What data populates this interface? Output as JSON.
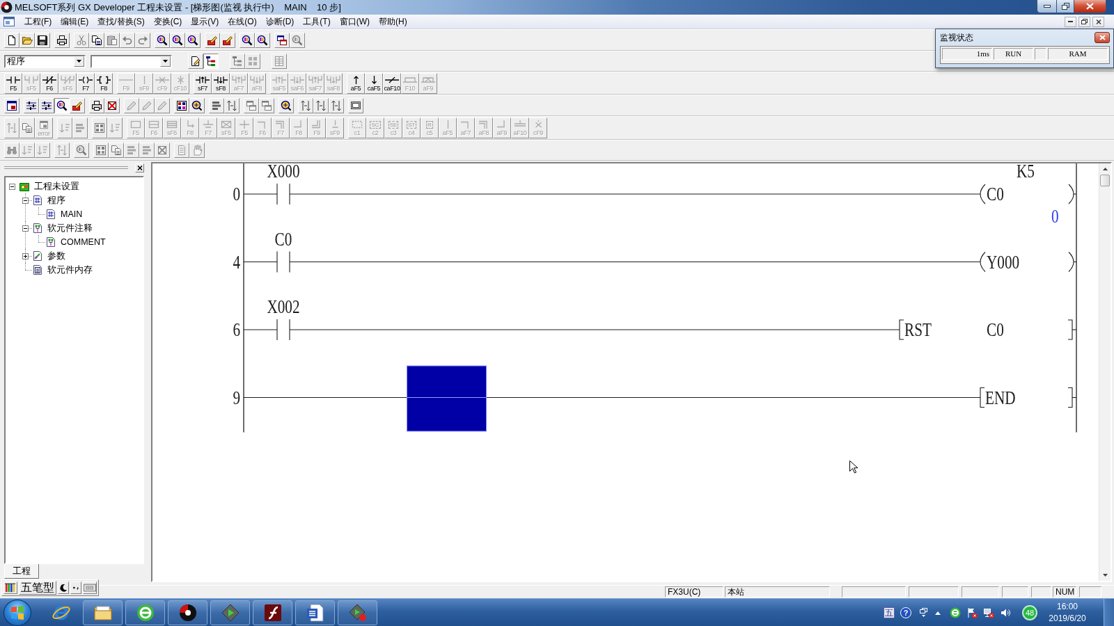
{
  "window": {
    "title": "MELSOFT系列 GX Developer 工程未设置 - [梯形图(监视 执行中)    MAIN    10 步]"
  },
  "menu": [
    "工程(F)",
    "编辑(E)",
    "查找/替换(S)",
    "变换(C)",
    "显示(V)",
    "在线(O)",
    "诊断(D)",
    "工具(T)",
    "窗口(W)",
    "帮助(H)"
  ],
  "toolbars": [
    {
      "groups": [
        [
          {
            "disabled": false
          },
          {
            "disabled": false
          },
          {
            "disabled": false
          }
        ],
        [
          {
            "disabled": false
          }
        ],
        [
          {
            "disabled": true
          },
          {
            "disabled": false
          },
          {
            "disabled": true
          },
          {
            "disabled": true
          },
          {
            "disabled": true
          }
        ],
        [
          {
            "disabled": false
          },
          {
            "disabled": false
          },
          {
            "disabled": false
          }
        ],
        [
          {
            "disabled": false
          },
          {
            "disabled": false
          }
        ],
        [
          {
            "disabled": false
          },
          {
            "disabled": false
          }
        ],
        [
          {
            "disabled": false
          },
          {
            "disabled": true
          }
        ]
      ]
    },
    {
      "groups": [
        [
          {
            "kind": "combo",
            "value": "程序"
          },
          {
            "kind": "combo"
          }
        ],
        [
          {
            "kind": "button",
            "disabled": false,
            "pressed": false
          },
          {
            "kind": "button",
            "disabled": false,
            "pressed": true
          }
        ],
        [
          {
            "kind": "button",
            "disabled": true
          },
          {
            "kind": "button",
            "disabled": true
          }
        ],
        [
          {
            "kind": "button",
            "disabled": true
          }
        ]
      ]
    },
    {
      "groups": [
        [
          {
            "key": "F5",
            "disabled": false
          },
          {
            "key": "sF5",
            "disabled": true
          },
          {
            "key": "F6",
            "disabled": false
          },
          {
            "key": "sF6",
            "disabled": true
          },
          {
            "key": "F7",
            "disabled": false
          },
          {
            "key": "F8",
            "disabled": false
          }
        ],
        [
          {
            "key": "F9",
            "disabled": true
          },
          {
            "key": "sF9",
            "disabled": true
          },
          {
            "key": "cF9",
            "disabled": true
          },
          {
            "key": "cF10",
            "disabled": true
          }
        ],
        [
          {
            "key": "sF7",
            "disabled": false
          },
          {
            "key": "sF8",
            "disabled": false
          },
          {
            "key": "aF7",
            "disabled": true
          },
          {
            "key": "aF8",
            "disabled": true
          }
        ],
        [
          {
            "key": "saF5",
            "disabled": true
          },
          {
            "key": "saF6",
            "disabled": true
          },
          {
            "key": "saF7",
            "disabled": true
          },
          {
            "key": "saF8",
            "disabled": true
          }
        ],
        [
          {
            "key": "aF5",
            "disabled": false
          },
          {
            "key": "caF5",
            "disabled": false
          },
          {
            "key": "caF10",
            "disabled": false
          },
          {
            "key": "F10",
            "disabled": true
          },
          {
            "key": "aF9",
            "disabled": true
          }
        ]
      ]
    },
    {
      "groups": [
        [
          {
            "disabled": false
          }
        ],
        [
          {
            "disabled": false,
            "pressed": false
          },
          {
            "disabled": false,
            "pressed": false
          },
          {
            "disabled": false,
            "pressed": true
          },
          {
            "disabled": false,
            "pressed": false
          }
        ],
        [
          {
            "disabled": false
          },
          {
            "disabled": false
          }
        ],
        [
          {
            "disabled": true
          },
          {
            "disabled": true
          },
          {
            "disabled": true
          }
        ],
        [
          {
            "disabled": false
          },
          {
            "disabled": false
          }
        ],
        [
          {
            "disabled": false
          },
          {
            "disabled": false
          }
        ],
        [
          {
            "disabled": true
          },
          {
            "disabled": true
          }
        ],
        [
          {
            "disabled": false
          }
        ],
        [
          {
            "disabled": false
          },
          {
            "disabled": false
          },
          {
            "disabled": false
          }
        ],
        [
          {
            "disabled": false
          }
        ]
      ]
    },
    {
      "groups": [
        [
          {
            "disabled": true
          },
          {
            "disabled": true
          },
          {
            "key": "error",
            "disabled": true
          }
        ],
        [
          {
            "disabled": true
          },
          {
            "disabled": true
          }
        ],
        [
          {
            "disabled": true
          },
          {
            "disabled": true
          }
        ],
        [
          {
            "key": "F5",
            "disabled": true
          },
          {
            "key": "F6",
            "disabled": true
          },
          {
            "key": "sF6",
            "disabled": true
          },
          {
            "key": "F8",
            "disabled": true
          },
          {
            "key": "F7",
            "disabled": true
          },
          {
            "key": "sF5",
            "disabled": true
          },
          {
            "key": "F5",
            "disabled": true
          },
          {
            "key": "F6",
            "disabled": true
          },
          {
            "key": "F7",
            "disabled": true
          },
          {
            "key": "F8",
            "disabled": true
          },
          {
            "key": "F9",
            "disabled": true
          },
          {
            "key": "sF9",
            "disabled": true
          }
        ],
        [
          {
            "key": "c1",
            "disabled": true
          },
          {
            "tag": "SC",
            "key": "c2",
            "disabled": true
          },
          {
            "tag": "SE",
            "key": "c3",
            "disabled": true
          },
          {
            "tag": "ST",
            "key": "c4",
            "disabled": true
          },
          {
            "tag": "R",
            "key": "c5",
            "disabled": true
          },
          {
            "key": "aF5",
            "disabled": true
          },
          {
            "key": "aF7",
            "disabled": true
          },
          {
            "key": "aF8",
            "disabled": true
          },
          {
            "key": "aF9",
            "disabled": true
          },
          {
            "key": "aF10",
            "disabled": true
          },
          {
            "key": "cF9",
            "disabled": true
          }
        ]
      ]
    },
    {
      "groups": [
        [
          {
            "disabled": true
          },
          {
            "disabled": true
          },
          {
            "disabled": true
          }
        ],
        [
          {
            "disabled": true
          }
        ],
        [
          {
            "disabled": true
          }
        ],
        [
          {
            "disabled": true
          },
          {
            "disabled": true
          },
          {
            "disabled": true
          },
          {
            "disabled": true
          },
          {
            "disabled": true
          }
        ],
        [
          {
            "disabled": true
          },
          {
            "disabled": true
          }
        ]
      ]
    }
  ],
  "monitor_window": {
    "title": "监视状态",
    "scan_time": "1ms",
    "status": "RUN",
    "memory": "RAM"
  },
  "left_panel": {
    "tree": [
      {
        "label": "工程未设置",
        "kind": "project",
        "expanded": true,
        "children": [
          {
            "label": "程序",
            "kind": "program",
            "expanded": true,
            "children": [
              {
                "label": "MAIN",
                "kind": "program"
              }
            ]
          },
          {
            "label": "软元件注释",
            "kind": "comment",
            "expanded": true,
            "children": [
              {
                "label": "COMMENT",
                "kind": "comment"
              }
            ]
          },
          {
            "label": "参数",
            "kind": "parameter",
            "expanded": false
          },
          {
            "label": "软元件内存",
            "kind": "memory"
          }
        ]
      }
    ],
    "tabs": [
      {
        "label": "工程",
        "selected": true
      }
    ]
  },
  "ladder": {
    "rungs": [
      {
        "step": "0",
        "cursor": false,
        "elements": [
          {
            "kind": "contact",
            "device": "X000"
          }
        ],
        "output": {
          "kind": "coil",
          "device": "C0",
          "setting": "K5",
          "value": "0"
        }
      },
      {
        "step": "4",
        "cursor": false,
        "elements": [
          {
            "kind": "contact",
            "device": "C0"
          }
        ],
        "output": {
          "kind": "coil",
          "device": "Y000"
        }
      },
      {
        "step": "6",
        "cursor": false,
        "elements": [
          {
            "kind": "contact",
            "device": "X002"
          }
        ],
        "output": {
          "kind": "instruction",
          "mnemonic": "RST",
          "operand": "C0"
        }
      },
      {
        "step": "9",
        "cursor": true,
        "output": {
          "kind": "end",
          "mnemonic": "END"
        }
      }
    ]
  },
  "status_bar": {
    "plc_type": "FX3U(C)",
    "station": "本站",
    "num_lock": "NUM"
  },
  "ime_bar": {
    "mode": "五笔型"
  },
  "taskbar": {
    "tray": {
      "ime": "五",
      "help": "?",
      "badge": "48"
    },
    "clock": {
      "time": "16:00",
      "date": "2019/6/20"
    }
  }
}
